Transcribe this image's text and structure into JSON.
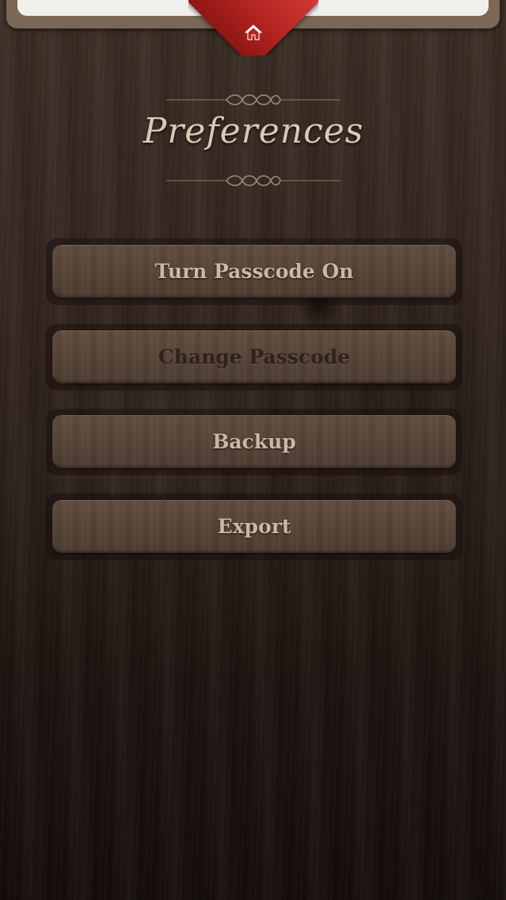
{
  "header": {
    "home_icon": "home-icon",
    "ribbon_color": "#b22420"
  },
  "page": {
    "title": "Preferences"
  },
  "buttons": [
    {
      "label": "Turn Passcode On",
      "enabled": true
    },
    {
      "label": "Change Passcode",
      "enabled": false
    },
    {
      "label": "Backup",
      "enabled": true
    },
    {
      "label": "Export",
      "enabled": true
    }
  ],
  "colors": {
    "button_text": "#cbb8a1",
    "button_text_disabled": "#2f221a",
    "title_text": "#d6c9b6",
    "background": "#2a1e18"
  }
}
